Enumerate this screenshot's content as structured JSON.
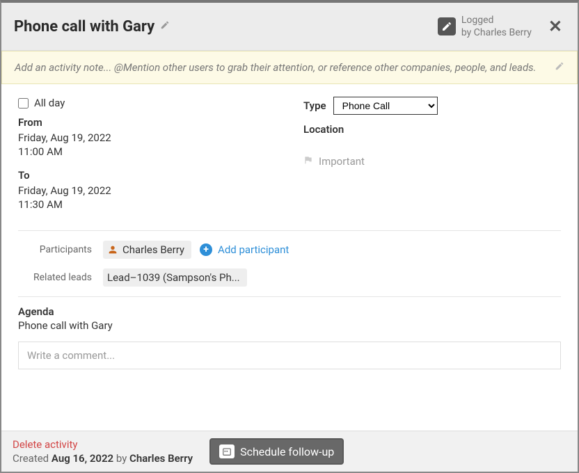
{
  "header": {
    "title": "Phone call with Gary",
    "logged_label": "Logged",
    "logged_by_prefix": "by",
    "logged_by_name": "Charles Berry"
  },
  "note": {
    "placeholder": "Add an activity note... @Mention other users to grab their attention, or reference other companies, people, and leads."
  },
  "datetime": {
    "allday_label": "All day",
    "from_label": "From",
    "from_date": "Friday, Aug 19, 2022",
    "from_time": "11:00 AM",
    "to_label": "To",
    "to_date": "Friday, Aug 19, 2022",
    "to_time": "11:30 AM"
  },
  "type": {
    "label": "Type",
    "selected": "Phone Call"
  },
  "location": {
    "label": "Location"
  },
  "important": {
    "label": "Important"
  },
  "participants": {
    "label": "Participants",
    "items": [
      "Charles Berry"
    ],
    "add_label": "Add participant"
  },
  "related_leads": {
    "label": "Related leads",
    "items": [
      "Lead–1039 (Sampson's Ph..."
    ]
  },
  "agenda": {
    "label": "Agenda",
    "text": "Phone call with Gary"
  },
  "comment": {
    "placeholder": "Write a comment..."
  },
  "footer": {
    "delete_label": "Delete activity",
    "created_prefix": "Created",
    "created_date": "Aug 16, 2022",
    "created_by_word": "by",
    "created_by_name": "Charles Berry",
    "schedule_label": "Schedule follow-up"
  }
}
